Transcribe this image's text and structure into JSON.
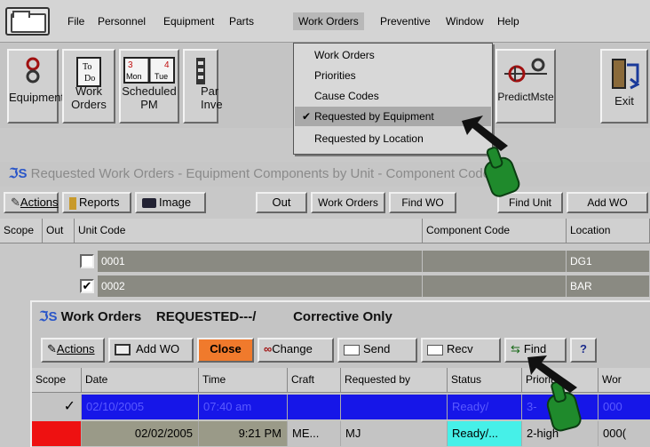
{
  "menubar": {
    "items": [
      "File",
      "Personnel",
      "Equipment",
      "Parts",
      "Work Orders",
      "Preventive",
      "Window",
      "Help"
    ],
    "active": "Work Orders"
  },
  "toolbar": {
    "buttons": [
      {
        "label1": "Equipment",
        "label2": "",
        "icon": "chain-link-icon"
      },
      {
        "label1": "Work",
        "label2": "Orders",
        "icon": "todo-note-icon",
        "icon_text": [
          "To",
          "Do"
        ]
      },
      {
        "label1": "Scheduled",
        "label2": "PM",
        "icon": "calendar-icon",
        "icon_text": [
          "3",
          "4",
          "Mon",
          "Tue"
        ]
      },
      {
        "label1": "Par",
        "label2": "Inve",
        "icon": "parts-icon"
      },
      {
        "label1": "PredictMste",
        "label2": "",
        "icon": "predict-icon"
      },
      {
        "label1": "Exit",
        "label2": "",
        "icon": "exit-door-icon"
      }
    ]
  },
  "dropdown": {
    "items": [
      "Work Orders",
      "Priorities",
      "Cause Codes",
      "Requested by Equipment",
      "Requested by Location"
    ],
    "selected_index": 3,
    "check": "✔"
  },
  "window1": {
    "title": "Requested Work Orders - Equipment Components by Unit - Component Code",
    "buttons": [
      "Actions",
      "Reports",
      "Image",
      "Out",
      "Work Orders",
      "Find WO",
      "Find Unit",
      "Add WO"
    ],
    "columns": [
      "Scope",
      "Out",
      "Unit Code",
      "Component Code",
      "Location"
    ],
    "rows": [
      {
        "checked": false,
        "unit_code": "0001",
        "component_code": "",
        "location": "DG1"
      },
      {
        "checked": true,
        "unit_code": "0002",
        "component_code": "",
        "location": "BAR"
      }
    ]
  },
  "window2": {
    "title": "Work Orders    REQUESTED---/          Corrective Only",
    "buttons": [
      "Actions",
      "Add WO",
      "Close",
      "Change",
      "Send",
      "Recv",
      "Find",
      "?"
    ],
    "columns": [
      "Scope",
      "Date",
      "Time",
      "Craft",
      "Requested by",
      "Status",
      "Priority",
      "Wor"
    ],
    "rows": [
      {
        "scope": "✓",
        "date": "02/10/2005",
        "time": "07:40 am",
        "craft": "",
        "requested_by": "",
        "status": "Ready/",
        "priority": "3-",
        "wo": "000"
      },
      {
        "scope": "",
        "date": "02/02/2005",
        "time": "9:21 PM",
        "craft": "ME...",
        "requested_by": "MJ",
        "status": "Ready/...",
        "priority": "2-high",
        "wo": "000("
      }
    ]
  },
  "colors": {
    "accent_close": "#f07a2c",
    "selected_row": "#1616e8",
    "scope_red": "#ee1111",
    "status_cyan": "#46f0e8",
    "hand_cursor": "#1f8a2c"
  }
}
